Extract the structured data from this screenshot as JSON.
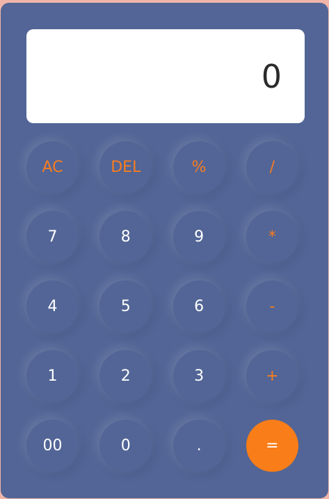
{
  "display": {
    "value": "0"
  },
  "keys": [
    [
      "AC",
      "DEL",
      "%",
      "/"
    ],
    [
      "7",
      "8",
      "9",
      "*"
    ],
    [
      "4",
      "5",
      "6",
      "-"
    ],
    [
      "1",
      "2",
      "3",
      "+"
    ],
    [
      "00",
      "0",
      ".",
      "="
    ]
  ],
  "colors": {
    "page_bg": "#f2b5a9",
    "calculator_bg": "#526596",
    "display_bg": "#ffffff",
    "operator_text": "#f97c1f",
    "equals_bg": "#f97d18",
    "digit_text": "#ffffff"
  }
}
